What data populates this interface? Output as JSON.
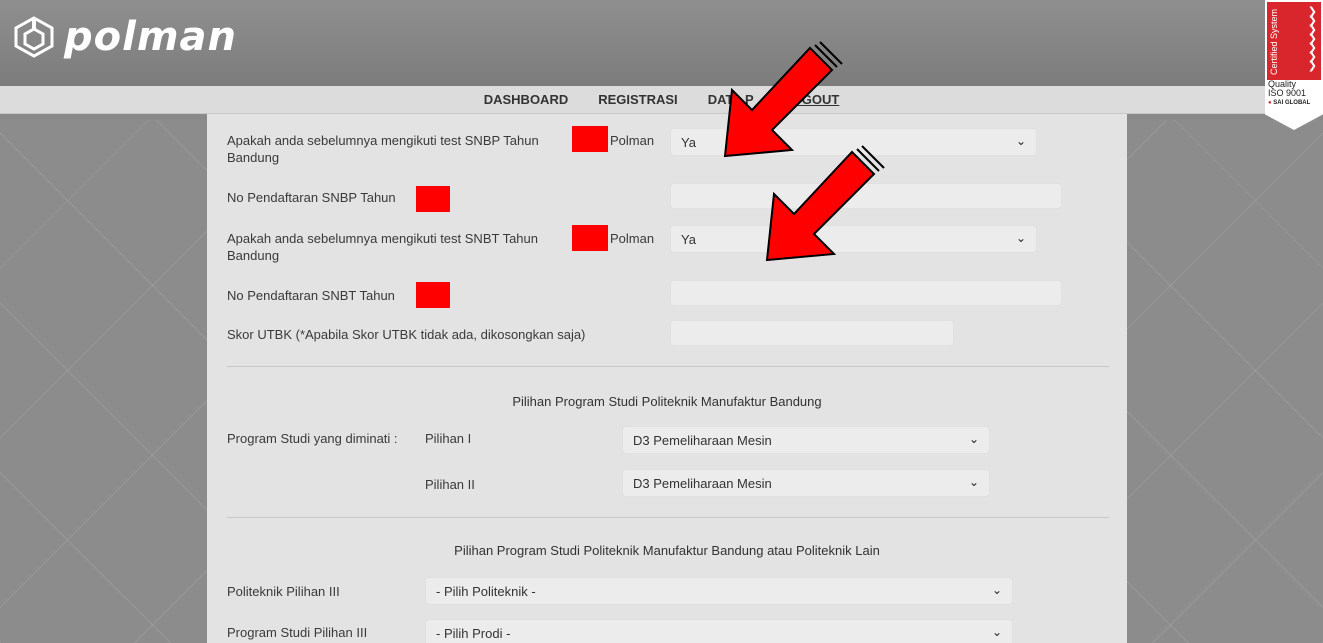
{
  "brand": {
    "name": "polman"
  },
  "nav": {
    "items": [
      {
        "label": "DASHBOARD"
      },
      {
        "label": "REGISTRASI"
      },
      {
        "label": "DATA P"
      },
      {
        "label": "LOGOUT"
      }
    ]
  },
  "badge": {
    "vertical": "Certified System",
    "line1": "Quality",
    "line2": "ISO 9001",
    "line3": "SAI GLOBAL"
  },
  "form": {
    "snbp_question_a": "Apakah anda sebelumnya mengikuti test SNBP Tahun",
    "snbp_question_b": "Polman",
    "snbp_question_c": "Bandung",
    "snbp_answer": "Ya",
    "snbp_no_label": "No Pendaftaran SNBP Tahun",
    "snbt_question_a": "Apakah anda sebelumnya mengikuti test SNBT Tahun",
    "snbt_question_b": "Polman",
    "snbt_question_c": "Bandung",
    "snbt_answer": "Ya",
    "snbt_no_label": "No Pendaftaran SNBT Tahun",
    "utbk_label": "Skor UTBK (*Apabila Skor UTBK tidak ada, dikosongkan saja)"
  },
  "section1": {
    "title": "Pilihan Program Studi Politeknik Manufaktur Bandung",
    "prodi_label": "Program Studi yang diminati :",
    "pilihan1_label": "Pilihan I",
    "pilihan1_value": "D3 Pemeliharaan Mesin",
    "pilihan2_label": "Pilihan II",
    "pilihan2_value": "D3 Pemeliharaan Mesin"
  },
  "section2": {
    "title": "Pilihan Program Studi Politeknik Manufaktur Bandung atau Politeknik Lain",
    "poltek3_label": "Politeknik Pilihan III",
    "poltek3_value": "- Pilih Politeknik -",
    "prodi3_label": "Program Studi Pilihan III",
    "prodi3_value": "- Pilih Prodi -"
  },
  "colors": {
    "header": "#858585",
    "navbar": "#dcdcdc",
    "panel": "#e3e3e3",
    "redaction": "#ff0000",
    "arrow": "#ff0000"
  },
  "icons": {
    "select_chevron": "chevron-down-icon",
    "logo": "polman-logo-icon",
    "arrow": "red-arrow-annotation"
  }
}
